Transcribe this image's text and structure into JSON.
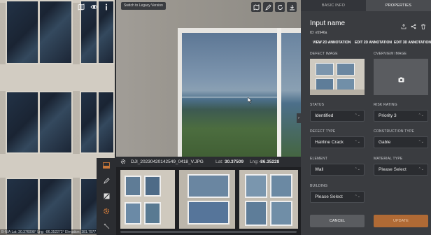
{
  "left_view": {
    "status_text": "B-N/A   Lat: 30.376098°   Lng: -86.352272°   Elevation: 381.7977 ft (ASL)"
  },
  "toolbar": {
    "legacy_button": "Switch to Legacy Version"
  },
  "filmstrip": {
    "filename": "DJI_20230420142549_0418_V.JPG",
    "lat_label": "Lat:",
    "lat_value": "30.37509",
    "lng_label": "Lng:",
    "lng_value": "-86.35228"
  },
  "panel": {
    "tabs": [
      {
        "label": "BASIC INFO"
      },
      {
        "label": "PROPERTIES"
      }
    ],
    "title": "Input name",
    "id_text": "ID: e5946a",
    "annotation_links": [
      {
        "label": "VIEW 2D ANNOTATION"
      },
      {
        "label": "EDIT 2D ANNOTATION"
      },
      {
        "label": "EDIT 3D ANNOTATION"
      }
    ],
    "defect_image_label": "DEFECT IMAGE",
    "overview_image_label": "OVERVIEW IMAGE",
    "fields": {
      "status": {
        "label": "STATUS",
        "value": "Identified"
      },
      "risk_rating": {
        "label": "RISK RATING",
        "value": "Priority 3"
      },
      "defect_type": {
        "label": "DEFECT TYPE",
        "value": "Hairline Crack"
      },
      "construction_type": {
        "label": "CONSTRUCTION TYPE",
        "value": "Gable"
      },
      "element": {
        "label": "ELEMENT",
        "value": "Wall"
      },
      "material_type": {
        "label": "MATERIAL TYPE",
        "value": "Please Select"
      },
      "building": {
        "label": "BUILDING",
        "value": "Please Select"
      }
    },
    "cancel_label": "CANCEL",
    "update_label": "UPDATE"
  },
  "colors": {
    "accent": "#c8773a",
    "panel_bg": "#3a3c40",
    "active_tab": "#4a4c50"
  },
  "icons": [
    "map-icon",
    "eye-icon",
    "info-icon",
    "layers-icon",
    "pen-icon",
    "refresh-icon",
    "download-icon",
    "image-icon",
    "edit-icon",
    "grid-icon",
    "gear-icon",
    "measure-icon",
    "share-icon",
    "link-icon",
    "trash-icon",
    "camera-icon",
    "settings-icon"
  ]
}
